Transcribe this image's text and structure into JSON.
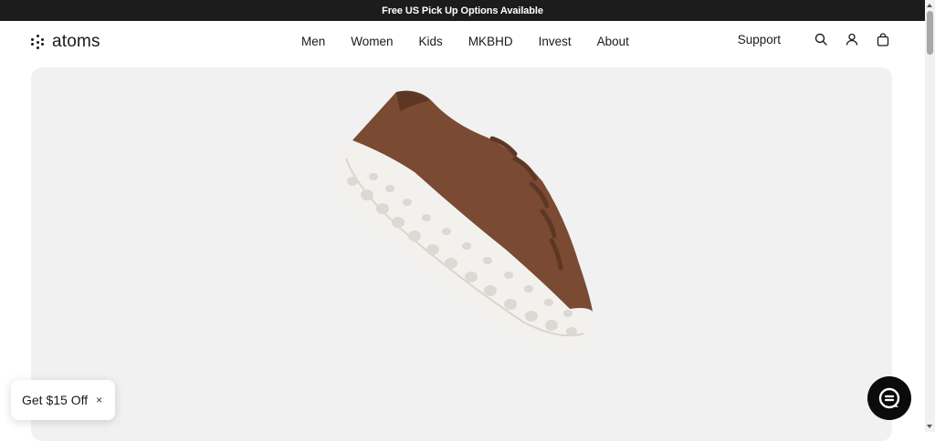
{
  "announcement": {
    "text": "Free US Pick Up Options Available"
  },
  "header": {
    "logo_text": "atoms",
    "nav": [
      {
        "label": "Men"
      },
      {
        "label": "Women"
      },
      {
        "label": "Kids"
      },
      {
        "label": "MKBHD"
      },
      {
        "label": "Invest"
      },
      {
        "label": "About"
      }
    ],
    "support_label": "Support",
    "icons": [
      "search-icon",
      "account-icon",
      "bag-icon"
    ]
  },
  "hero": {
    "image": "sneaker-product-image",
    "colors": {
      "upper": "#7a4a33",
      "sole": "#f3f1ee",
      "background": "#f1f1f1"
    }
  },
  "promo": {
    "label": "Get $15 Off",
    "close_symbol": "×"
  },
  "chat": {
    "icon": "chat-icon"
  }
}
